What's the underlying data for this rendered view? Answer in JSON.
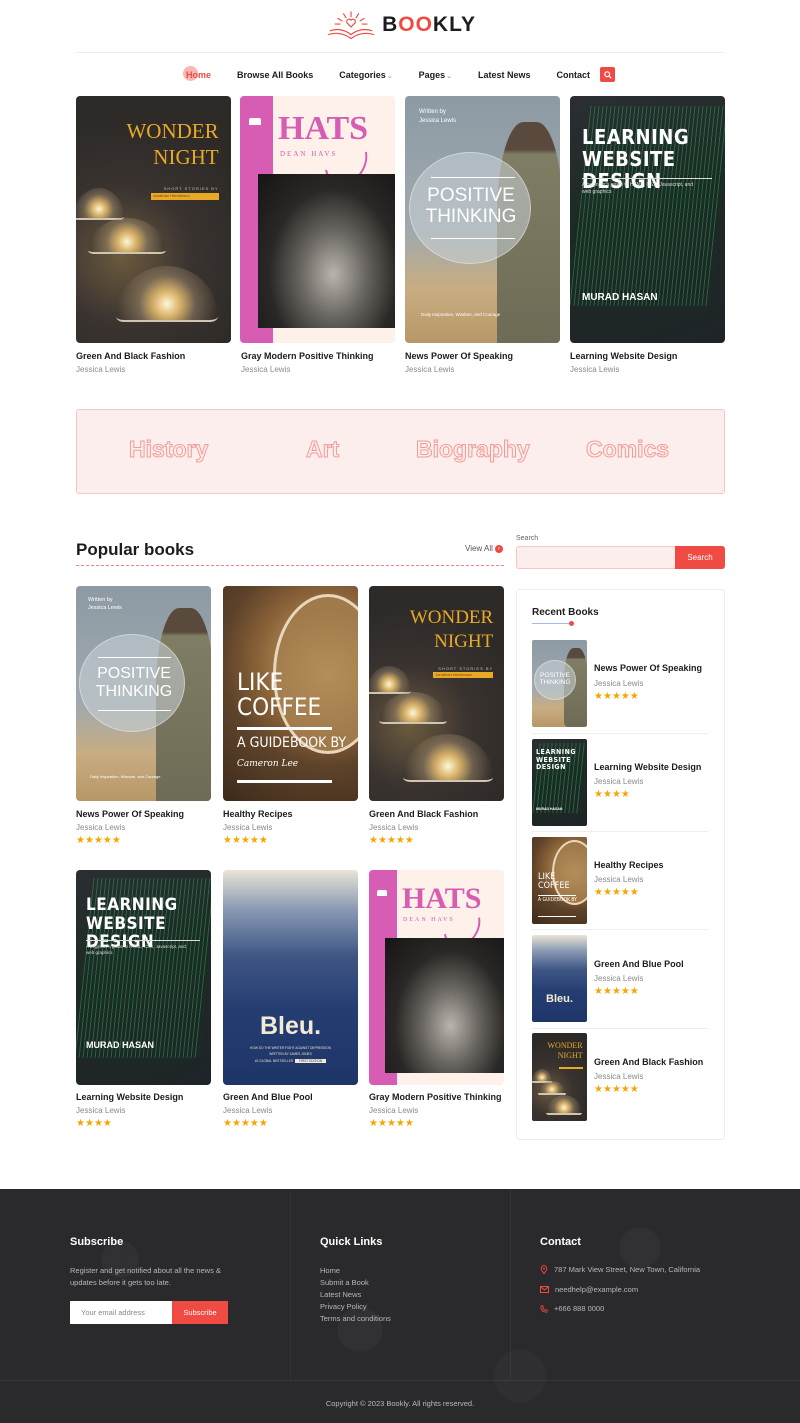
{
  "brand": {
    "name_prefix": "B",
    "name_highlight": "OO",
    "name_suffix": "KLY",
    "accent": "#f04b43"
  },
  "nav": {
    "items": [
      {
        "label": "Home",
        "active": true
      },
      {
        "label": "Browse All Books"
      },
      {
        "label": "Categories",
        "dropdown": true
      },
      {
        "label": "Pages",
        "dropdown": true
      },
      {
        "label": "Latest News"
      },
      {
        "label": "Contact"
      }
    ],
    "search_icon": "search-icon"
  },
  "featured": [
    {
      "title": "Green And Black Fashion",
      "author": "Jessica Lewis",
      "cover": {
        "title1": "WONDER",
        "title2": "NIGHT",
        "sub": "SHORT STORIES BY",
        "author": "Jonathan Henderson"
      }
    },
    {
      "title": "Gray Modern Positive Thinking",
      "author": "Jessica Lewis",
      "cover": {
        "title": "HATS",
        "author": "DEAN HAVS"
      }
    },
    {
      "title": "News Power Of Speaking",
      "author": "Jessica Lewis",
      "cover": {
        "written_by": "Written by",
        "author": "Jessica Lewis",
        "title1": "POSITIVE",
        "title2": "THINKING",
        "tagline": "Daily Inspiration, Wisdom, and Courage"
      }
    },
    {
      "title": "Learning Website Design",
      "author": "Jessica Lewis",
      "cover": {
        "title1": "LEARNING",
        "title2": "WEBSITE DESIGN",
        "sub": "A beginner's guide to HTML, CSS, Javascript, and web graphics",
        "author": "MURAD HASAN"
      }
    }
  ],
  "categories": [
    "History",
    "Art",
    "Biography",
    "Comics"
  ],
  "popular": {
    "title": "Popular books",
    "view_all": "View All",
    "books": [
      {
        "title": "News Power Of Speaking",
        "author": "Jessica Lewis",
        "rating": 5
      },
      {
        "title": "Healthy Recipes",
        "author": "Jessica Lewis",
        "rating": 5,
        "cover": {
          "title1": "LIKE",
          "title2": "COFFEE",
          "sub": "A GUIDEBOOK BY",
          "author": "Cameron Lee"
        }
      },
      {
        "title": "Green And Black Fashion",
        "author": "Jessica Lewis",
        "rating": 5
      },
      {
        "title": "Learning Website Design",
        "author": "Jessica Lewis",
        "rating": 4
      },
      {
        "title": "Green And Blue Pool",
        "author": "Jessica Lewis",
        "rating": 5,
        "cover": {
          "title": "Bleu.",
          "sub1": "HOW DO THE WRITER FIGHT AGAINST DEPRESSION",
          "sub2": "WRITTEN BY JAMES JONES",
          "badge": "#1 GLOBAL BESTSELLER",
          "edition": "FIRST EDITION"
        }
      },
      {
        "title": "Gray Modern Positive Thinking",
        "author": "Jessica Lewis",
        "rating": 5
      }
    ]
  },
  "sidebar": {
    "search_label": "Search",
    "search_placeholder": "",
    "search_button": "Search",
    "recent_title": "Recent Books",
    "recent": [
      {
        "title": "News Power Of Speaking",
        "author": "Jessica Lewis",
        "rating": 5
      },
      {
        "title": "Learning Website Design",
        "author": "Jessica Lewis",
        "rating": 4
      },
      {
        "title": "Healthy Recipes",
        "author": "Jessica Lewis",
        "rating": 5
      },
      {
        "title": "Green And Blue Pool",
        "author": "Jessica Lewis",
        "rating": 5
      },
      {
        "title": "Green And Black Fashion",
        "author": "Jessica Lewis",
        "rating": 5
      }
    ]
  },
  "footer": {
    "subscribe": {
      "title": "Subscribe",
      "text1": "Register and get notified about all the news &",
      "text2": "updates before it gets too late.",
      "placeholder": "Your email address",
      "button": "Subscribe"
    },
    "quick_links": {
      "title": "Quick Links",
      "items": [
        "Home",
        "Submit a Book",
        "Latest News",
        "Privacy Policy",
        "Terms and conditions"
      ]
    },
    "contact": {
      "title": "Contact",
      "address": "787 Mark View Street, New Town, California",
      "email": "needhelp@example.com",
      "phone": "+666 888 0000"
    },
    "copyright": "Copyright © 2023 Bookly. All rights reserved."
  }
}
